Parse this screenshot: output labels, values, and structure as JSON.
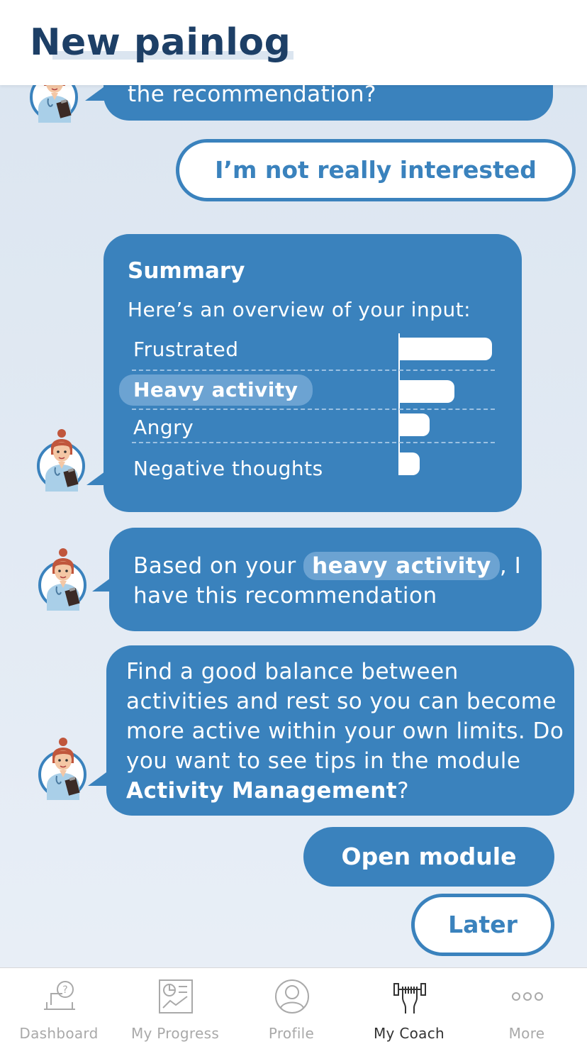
{
  "header": {
    "title": "New painlog"
  },
  "chat": {
    "prev_coach_message": "the recommendation?",
    "user_reply": "I’m not really interested",
    "summary": {
      "title": "Summary",
      "subtitle": "Here’s an overview of your input:",
      "rows": [
        {
          "label": "Frustrated",
          "value": 1.0,
          "highlighted": false
        },
        {
          "label": "Heavy activity",
          "value": 0.6,
          "highlighted": true
        },
        {
          "label": "Angry",
          "value": 0.33,
          "highlighted": false
        },
        {
          "label": "Negative thoughts",
          "value": 0.23,
          "highlighted": false
        }
      ]
    },
    "based_on": {
      "prefix": "Based on your",
      "chip": "heavy activity",
      "suffix": ", I",
      "line2": "have this recommendation"
    },
    "recommendation": {
      "text": "Find a good balance between activities and rest so you can become more active within your own limits. Do you want to see tips in the module",
      "module": "Activity Management",
      "end": "?"
    },
    "actions": {
      "open_module": "Open module",
      "later": "Later"
    }
  },
  "nav": {
    "items": [
      {
        "label": "Dashboard",
        "icon": "dashboard-question-icon",
        "active": false
      },
      {
        "label": "My Progress",
        "icon": "progress-report-icon",
        "active": false
      },
      {
        "label": "Profile",
        "icon": "profile-person-icon",
        "active": false
      },
      {
        "label": "My Coach",
        "icon": "coach-dumbbell-icon",
        "active": true
      },
      {
        "label": "More",
        "icon": "more-dots-icon",
        "active": false
      }
    ]
  },
  "colors": {
    "primary": "#3a82bd",
    "title": "#1d3f66",
    "chip": "#6ca3d2",
    "background": "#dbe5f0"
  }
}
